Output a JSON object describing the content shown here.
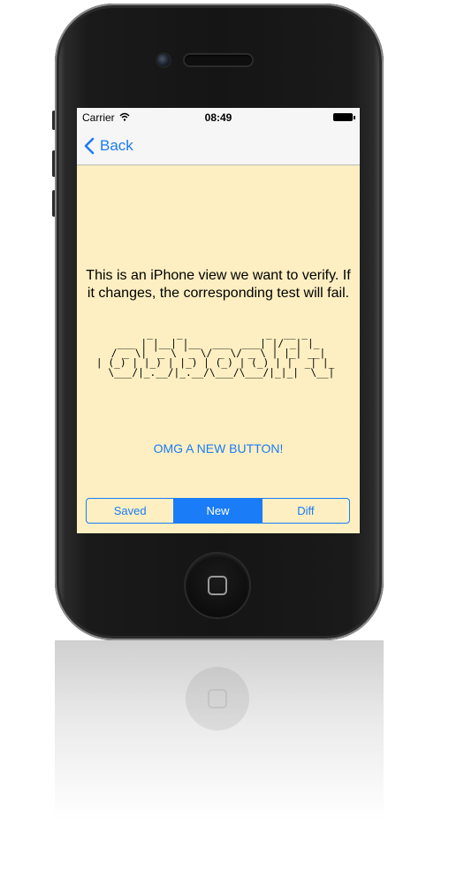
{
  "status_bar": {
    "carrier": "Carrier",
    "time": "08:49",
    "wifi_icon": "wifi-icon",
    "battery_icon": "battery-icon"
  },
  "navbar": {
    "back_label": "Back",
    "back_icon": "chevron-left-icon"
  },
  "content": {
    "message": "This is an iPhone view we want to verify. If it changes, the corresponding test will fail.",
    "ascii_art": "       _    _              _  __ _    \n  ___ | |__| |__  ___  ___| |/ _| |_  \n / _ \\| '_ \\ '_ \\/ _ \\/ _ \\ | |_| __| \n| (_) | |_) | |_) | (_) | (_) | |  _| |_ \n \\___/|_.__/|_.__/\\___/\\___/|_|_|  \\__|",
    "button_label": "OMG A NEW BUTTON!"
  },
  "segmented_control": {
    "segments": [
      "Saved",
      "New",
      "Diff"
    ],
    "selected": "New"
  },
  "colors": {
    "accent": "#1a7cf6",
    "screen_background": "#fdefc2",
    "navbar_background": "#f6f6f6"
  }
}
